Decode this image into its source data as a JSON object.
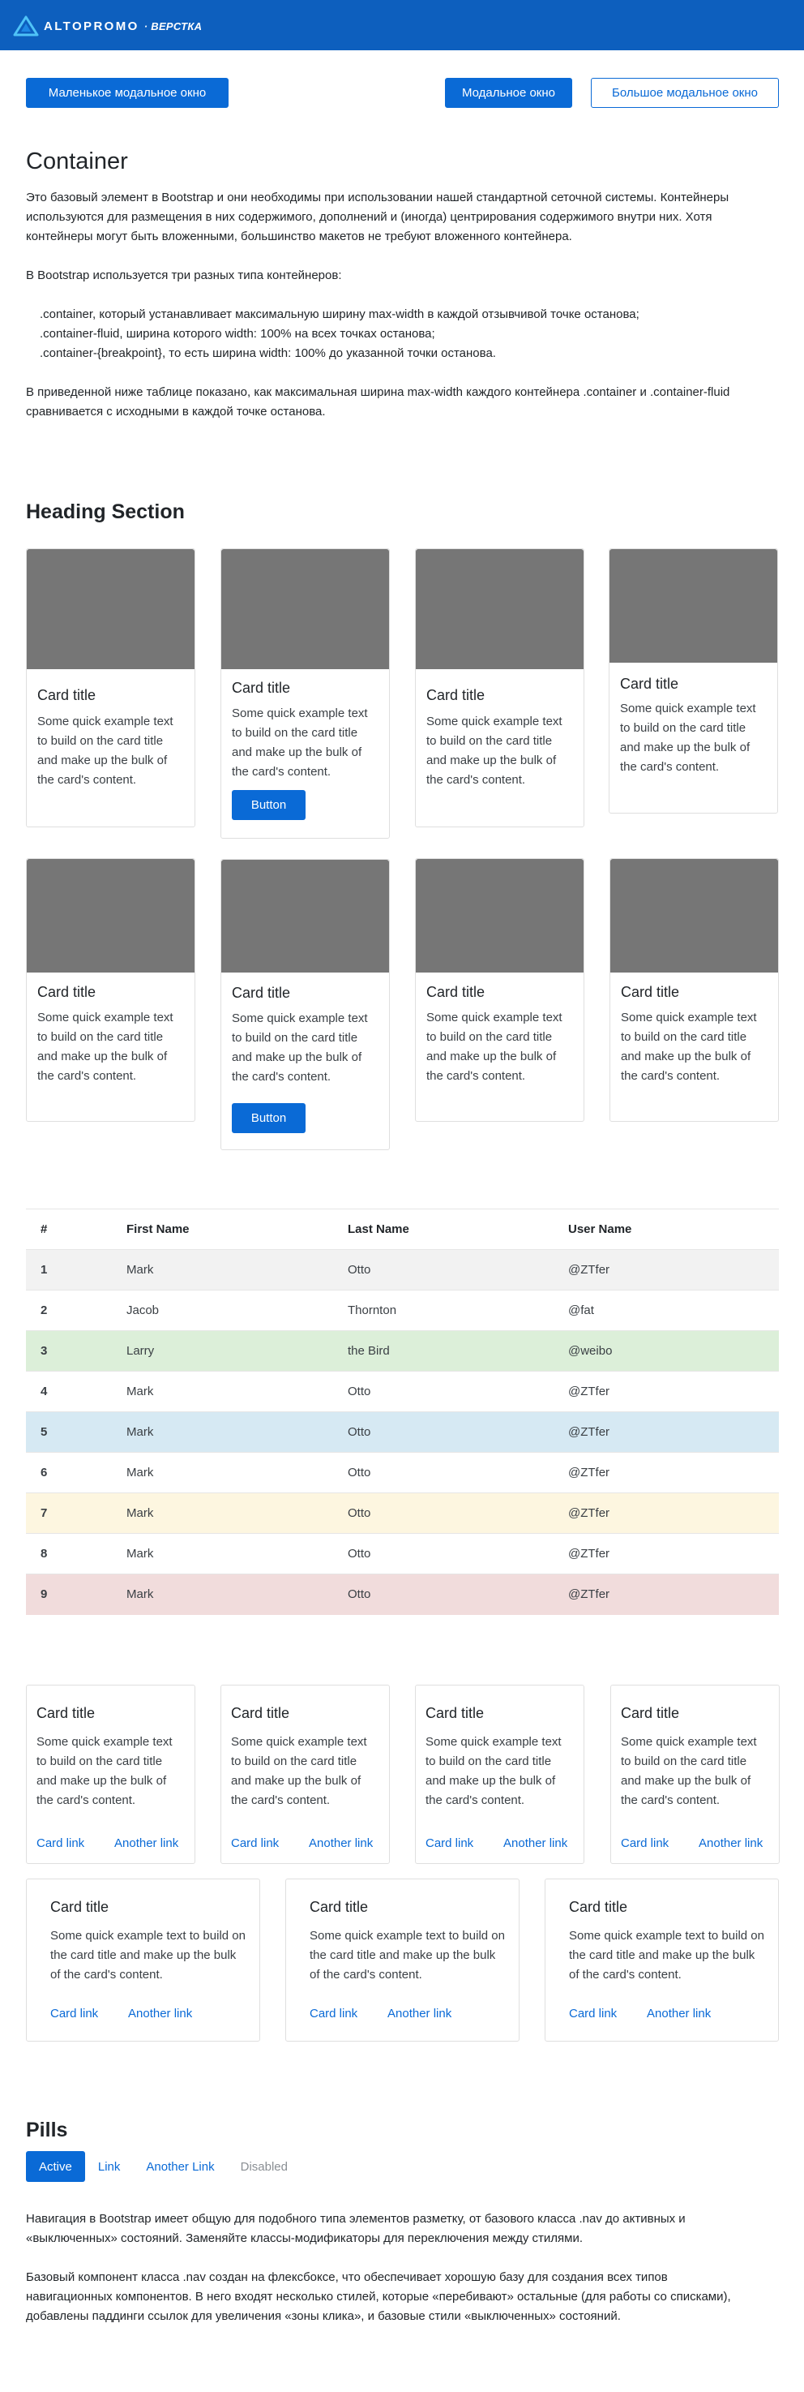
{
  "header": {
    "logo_text": "ALTOPROMO",
    "logo_sub": "· ВЕРСТКА",
    "bg_color": "#0d5fbe"
  },
  "buttons": {
    "small_modal": "Маленькое модальное окно",
    "modal": "Модальное окно",
    "large_modal": "Большое модальное окно"
  },
  "container_section": {
    "title": "Container",
    "intro": "Это базовый элемент в Bootstrap и они необходимы при использовании нашей стандартной сеточной системы. Контейнеры используются для размещения в них содержимого, дополнений и (иногда) центрирования содержимого внутри них. Хотя контейнеры могут быть вложенными, большинство макетов не требуют вложенного контейнера.",
    "types_intro": "В Bootstrap используется три разных типа контейнеров:",
    "types": [
      ".container, который устанавливает максимальную ширину max-width в каждой отзывчивой точке останова;",
      ".container-fluid, ширина которого width: 100% на всех точках останова;",
      ".container-{breakpoint}, то есть ширина width: 100% до указанной точки останова."
    ],
    "table_note": "В приведенной ниже таблице показано, как максимальная ширина max-width каждого контейнера .container и .container-fluid сравнивается с исходными в каждой точке останова."
  },
  "heading_section": {
    "title": "Heading Section"
  },
  "cards": {
    "title": "Card title",
    "text": "Some quick example text to build on the card title and make up the bulk of the card's content.",
    "button": "Button"
  },
  "table": {
    "headers": [
      "#",
      "First Name",
      "Last Name",
      "User Name"
    ],
    "rows": [
      {
        "num": "1",
        "first": "Mark",
        "last": "Otto",
        "user": "@ZTfer",
        "bg": "#f2f2f2"
      },
      {
        "num": "2",
        "first": "Jacob",
        "last": "Thornton",
        "user": "@fat",
        "bg": "#ffffff"
      },
      {
        "num": "3",
        "first": "Larry",
        "last": "the Bird",
        "user": "@weibo",
        "bg": "#dcefd9"
      },
      {
        "num": "4",
        "first": "Mark",
        "last": "Otto",
        "user": "@ZTfer",
        "bg": "#ffffff"
      },
      {
        "num": "5",
        "first": "Mark",
        "last": "Otto",
        "user": "@ZTfer",
        "bg": "#d6e9f3"
      },
      {
        "num": "6",
        "first": "Mark",
        "last": "Otto",
        "user": "@ZTfer",
        "bg": "#ffffff"
      },
      {
        "num": "7",
        "first": "Mark",
        "last": "Otto",
        "user": "@ZTfer",
        "bg": "#fdf6e0"
      },
      {
        "num": "8",
        "first": "Mark",
        "last": "Otto",
        "user": "@ZTfer",
        "bg": "#ffffff"
      },
      {
        "num": "9",
        "first": "Mark",
        "last": "Otto",
        "user": "@ZTfer",
        "bg": "#f1dcdc"
      }
    ]
  },
  "link_cards": {
    "title": "Card title",
    "text": "Some quick example text to build on the card title and make up the bulk of the card's content.",
    "link1": "Card link",
    "link2": "Another link"
  },
  "pills": {
    "title": "Pills",
    "items": [
      {
        "label": "Active",
        "state": "active"
      },
      {
        "label": "Link",
        "state": "normal"
      },
      {
        "label": "Another Link",
        "state": "normal"
      },
      {
        "label": "Disabled",
        "state": "disabled"
      }
    ],
    "para1": "Навигация в Bootstrap имеет общую для подобного типа элементов разметку, от базового класса .nav до активных и «выключенных» состояний. Заменяйте классы-модификаторы для переключения между стилями.",
    "para2": "Базовый компонент класса .nav создан на флексбоксе, что обеспечивает хорошую базу для создания всех типов навигационных компонентов. В него входят несколько стилей, которые «перебивают» остальные (для работы со списками), добавлены паддинги ссылок для увеличения «зоны клика», и базовые стили «выключенных» состояний."
  },
  "colors": {
    "primary": "#0a6ad6",
    "image_placeholder": "#767676"
  }
}
